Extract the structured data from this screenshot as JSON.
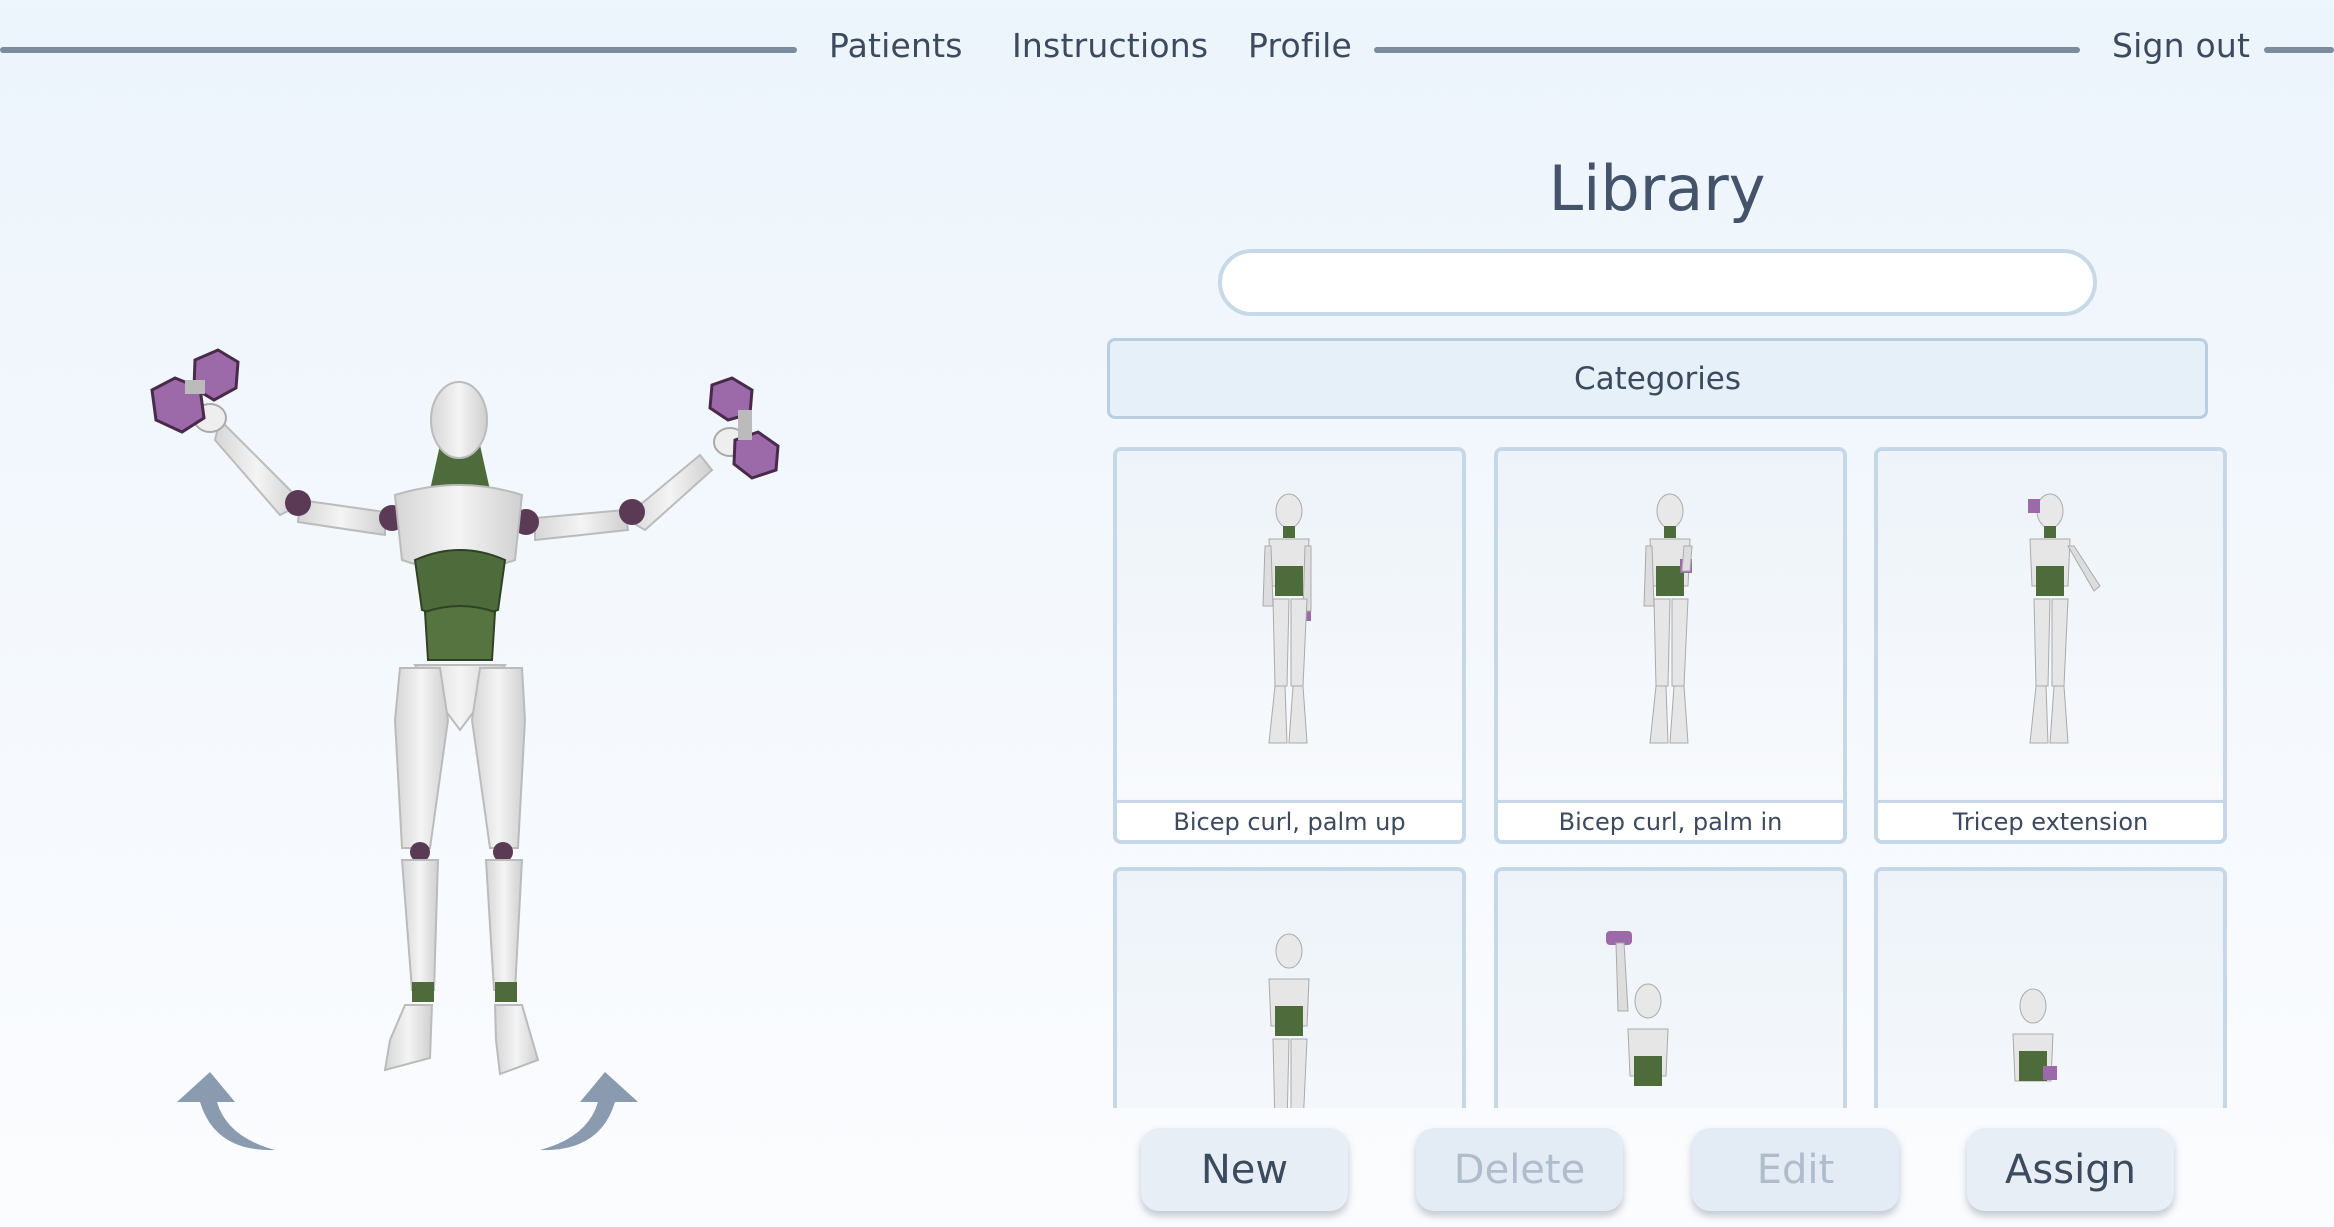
{
  "nav": {
    "items": [
      {
        "label": "Patients"
      },
      {
        "label": "Instructions"
      },
      {
        "label": "Profile"
      }
    ],
    "sign_out": "Sign out"
  },
  "library": {
    "title": "Library",
    "search_value": "",
    "categories_label": "Categories",
    "exercises": [
      {
        "caption": "Bicep curl, palm up"
      },
      {
        "caption": "Bicep curl, palm in"
      },
      {
        "caption": "Tricep extension"
      },
      {
        "caption": ""
      },
      {
        "caption": ""
      },
      {
        "caption": ""
      }
    ]
  },
  "actions": {
    "new": "New",
    "delete": "Delete",
    "edit": "Edit",
    "assign": "Assign"
  },
  "colors": {
    "accent_line": "#7b8c9f",
    "figure_body": "#ececec",
    "figure_torso": "#4e6b3c",
    "dumbbell": "#9c6aa8"
  }
}
